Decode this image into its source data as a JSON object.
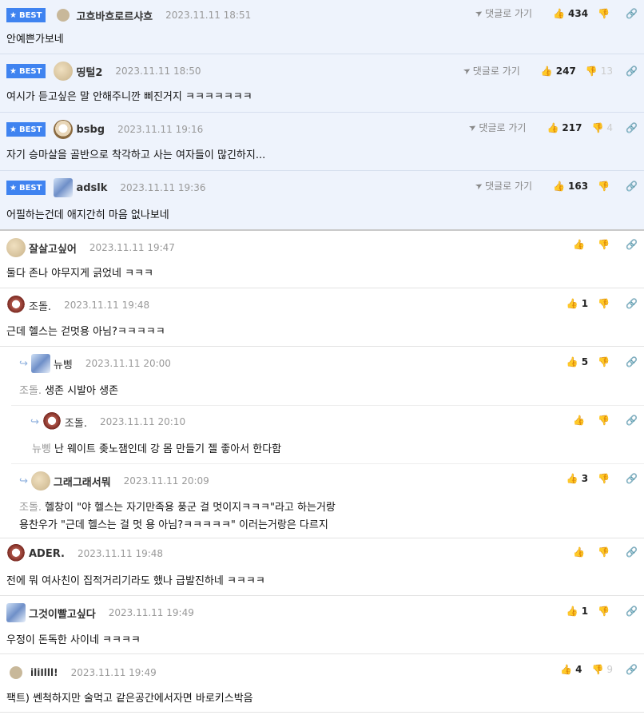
{
  "labels": {
    "best_badge": "BEST",
    "goto_reply": "댓글로 가기"
  },
  "icons": {
    "star": "star-icon",
    "goto": "arrow-icon",
    "thumbs_up": "thumbs-up-icon",
    "thumbs_down": "thumbs-down-icon",
    "link": "link-icon",
    "reply": "reply-arrow-icon"
  },
  "colors": {
    "best_badge_bg": "#3f83f0",
    "best_row_bg": "#eef3fc",
    "muted_text": "#999999"
  },
  "best_comments": [
    {
      "nick": "고흐바흐로르샤흐",
      "date": "2023.11.11 18:51",
      "text": "안예쁜가보네",
      "likes": "434",
      "dislikes": ""
    },
    {
      "nick": "띵털2",
      "date": "2023.11.11 18:50",
      "text": "여시가 듣고싶은 말 안해주니깐 삐진거지 ㅋㅋㅋㅋㅋㅋㅋ",
      "likes": "247",
      "dislikes": "13"
    },
    {
      "nick": "bsbg",
      "date": "2023.11.11 19:16",
      "text": "자기 승마살을 골반으로 착각하고 사는 여자들이 많긴하지...",
      "likes": "217",
      "dislikes": "4"
    },
    {
      "nick": "adslk",
      "date": "2023.11.11 19:36",
      "text": "어필하는건데 애지간히 마음 없나보네",
      "likes": "163",
      "dislikes": ""
    }
  ],
  "comments": [
    {
      "nick": "잘살고싶어",
      "date": "2023.11.11 19:47",
      "text": "둘다 존나 야무지게 긁었네 ㅋㅋㅋ",
      "likes": "",
      "dislikes": ""
    },
    {
      "nick": "조돌.",
      "date": "2023.11.11 19:48",
      "text": "근데 헬스는 걷멋용 아님?ㅋㅋㅋㅋㅋ",
      "likes": "1",
      "dislikes": ""
    },
    {
      "nick": "뉴삥",
      "date": "2023.11.11 20:00",
      "parent": "조돌.",
      "text": "생존 시발아 생존",
      "likes": "5",
      "dislikes": ""
    },
    {
      "nick": "조돌.",
      "date": "2023.11.11 20:10",
      "parent": "뉴삥",
      "text": "난 웨이트 좆노잼인데 강 몸 만들기 젤 좋아서 한다함",
      "likes": "",
      "dislikes": ""
    },
    {
      "nick": "그래그래서뭐",
      "date": "2023.11.11 20:09",
      "parent": "조돌.",
      "text": "헬창이 \"야 헬스는 자기만족용 풍군 걸 멋이지ㅋㅋㅋ\"라고 하는거랑",
      "text2": "용찬우가 \"근데 헬스는 걸 멋 용 아님?ㅋㅋㅋㅋㅋ\" 이러는거랑은 다르지",
      "likes": "3",
      "dislikes": ""
    },
    {
      "nick": "ADER.",
      "date": "2023.11.11 19:48",
      "text": "전에 뭐 여사친이 집적거리기라도 했나 급발진하네 ㅋㅋㅋㅋ",
      "likes": "",
      "dislikes": ""
    },
    {
      "nick": "그것이빨고싶다",
      "date": "2023.11.11 19:49",
      "text": "우정이 돈독한 사이네 ㅋㅋㅋㅋ",
      "likes": "1",
      "dislikes": ""
    },
    {
      "nick": "iliIlll!",
      "date": "2023.11.11 19:49",
      "text": "팩트) 쎈척하지만 술먹고 같은공간에서자면 바로키스박음",
      "likes": "4",
      "dislikes": "9"
    }
  ]
}
